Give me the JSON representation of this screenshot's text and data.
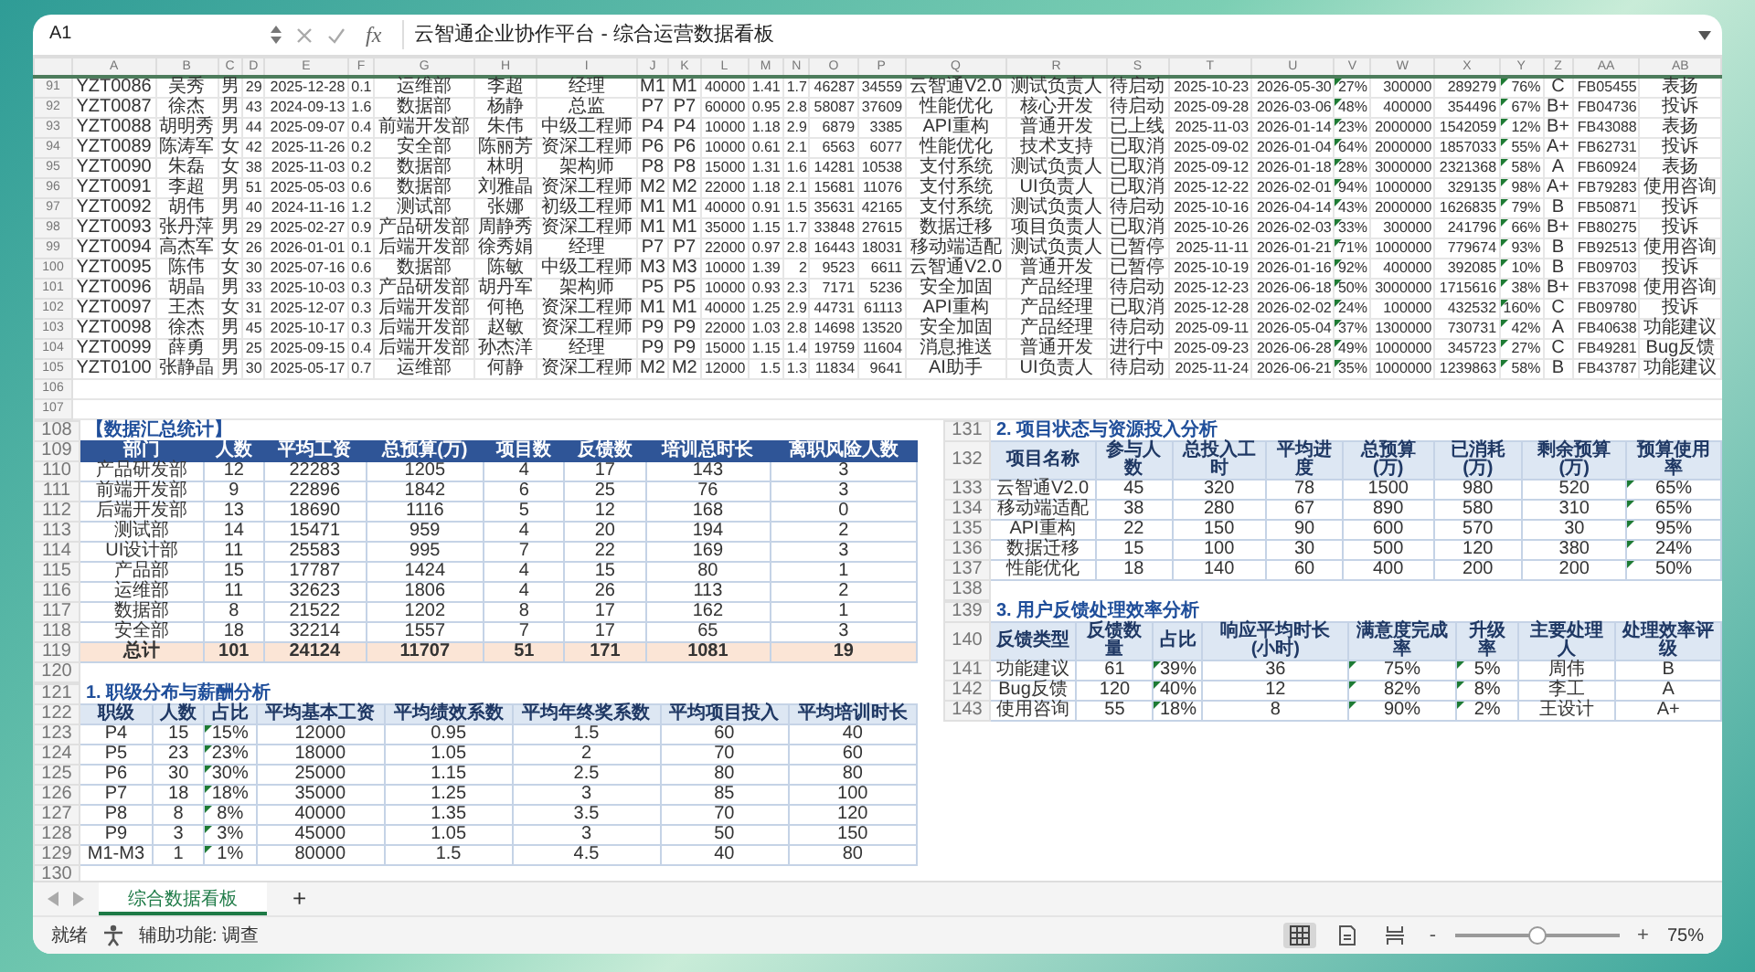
{
  "formula_bar": {
    "cell": "A1",
    "fx": "fx",
    "content": "云智通企业协作平台 - 综合运营数据看板"
  },
  "sheet": {
    "columns": [
      {
        "letter": "A",
        "kind": "text",
        "flag": false
      },
      {
        "letter": "B",
        "kind": "text",
        "flag": false
      },
      {
        "letter": "C",
        "kind": "text",
        "flag": false
      },
      {
        "letter": "D",
        "kind": "number",
        "flag": false
      },
      {
        "letter": "E",
        "kind": "number",
        "flag": false
      },
      {
        "letter": "F",
        "kind": "number",
        "flag": false
      },
      {
        "letter": "G",
        "kind": "text",
        "flag": false
      },
      {
        "letter": "H",
        "kind": "text",
        "flag": false
      },
      {
        "letter": "I",
        "kind": "text",
        "flag": false
      },
      {
        "letter": "J",
        "kind": "text",
        "flag": false
      },
      {
        "letter": "K",
        "kind": "text",
        "flag": false
      },
      {
        "letter": "L",
        "kind": "number",
        "flag": false
      },
      {
        "letter": "M",
        "kind": "number",
        "flag": false
      },
      {
        "letter": "N",
        "kind": "number",
        "flag": false
      },
      {
        "letter": "O",
        "kind": "number",
        "flag": false
      },
      {
        "letter": "P",
        "kind": "number",
        "flag": false
      },
      {
        "letter": "Q",
        "kind": "text",
        "flag": false
      },
      {
        "letter": "R",
        "kind": "text",
        "flag": false
      },
      {
        "letter": "S",
        "kind": "text",
        "flag": false
      },
      {
        "letter": "T",
        "kind": "number",
        "flag": false
      },
      {
        "letter": "U",
        "kind": "number",
        "flag": false
      },
      {
        "letter": "V",
        "kind": "number",
        "flag": true
      },
      {
        "letter": "W",
        "kind": "number",
        "flag": false
      },
      {
        "letter": "X",
        "kind": "number",
        "flag": false
      },
      {
        "letter": "Y",
        "kind": "number",
        "flag": true
      },
      {
        "letter": "Z",
        "kind": "text",
        "flag": false
      },
      {
        "letter": "AA",
        "kind": "number",
        "flag": false
      },
      {
        "letter": "AB",
        "kind": "text",
        "flag": false
      }
    ],
    "rows": [
      {
        "row": "91",
        "cells": [
          "YZT0086",
          "吴秀",
          "男",
          "29",
          "2025-12-28",
          "0.1",
          "运维部",
          "李超",
          "经理",
          "M1",
          "M1",
          "40000",
          "1.41",
          "1.7",
          "46287",
          "34559",
          "云智通V2.0",
          "测试负责人",
          "待启动",
          "2025-10-23",
          "2026-05-30",
          "27%",
          "300000",
          "289279",
          "76%",
          "C",
          "FB05455",
          "表扬"
        ]
      },
      {
        "row": "92",
        "cells": [
          "YZT0087",
          "徐杰",
          "男",
          "43",
          "2024-09-13",
          "1.6",
          "数据部",
          "杨静",
          "总监",
          "P7",
          "P7",
          "60000",
          "0.95",
          "2.8",
          "58087",
          "37609",
          "性能优化",
          "核心开发",
          "待启动",
          "2025-09-28",
          "2026-03-06",
          "48%",
          "400000",
          "354496",
          "67%",
          "B+",
          "FB04736",
          "投诉"
        ]
      },
      {
        "row": "93",
        "cells": [
          "YZT0088",
          "胡明秀",
          "男",
          "44",
          "2025-09-07",
          "0.4",
          "前端开发部",
          "朱伟",
          "中级工程师",
          "P4",
          "P4",
          "10000",
          "1.18",
          "2.9",
          "6879",
          "3385",
          "API重构",
          "普通开发",
          "已上线",
          "2025-11-03",
          "2026-01-14",
          "23%",
          "2000000",
          "1542059",
          "12%",
          "B+",
          "FB43088",
          "表扬"
        ]
      },
      {
        "row": "94",
        "cells": [
          "YZT0089",
          "陈涛军",
          "女",
          "42",
          "2025-11-26",
          "0.2",
          "安全部",
          "陈丽芳",
          "资深工程师",
          "P6",
          "P6",
          "10000",
          "0.61",
          "2.1",
          "6563",
          "6077",
          "性能优化",
          "技术支持",
          "已取消",
          "2025-09-02",
          "2026-01-04",
          "64%",
          "2000000",
          "1857033",
          "55%",
          "A+",
          "FB62731",
          "投诉"
        ]
      },
      {
        "row": "95",
        "cells": [
          "YZT0090",
          "朱磊",
          "女",
          "38",
          "2025-11-03",
          "0.2",
          "数据部",
          "林明",
          "架构师",
          "P8",
          "P8",
          "15000",
          "1.31",
          "1.6",
          "14281",
          "10538",
          "支付系统",
          "测试负责人",
          "已取消",
          "2025-09-12",
          "2026-01-18",
          "28%",
          "3000000",
          "2321368",
          "58%",
          "A",
          "FB60924",
          "表扬"
        ]
      },
      {
        "row": "96",
        "cells": [
          "YZT0091",
          "李超",
          "男",
          "51",
          "2025-05-03",
          "0.6",
          "数据部",
          "刘雅晶",
          "资深工程师",
          "M2",
          "M2",
          "22000",
          "1.18",
          "2.1",
          "15681",
          "11076",
          "支付系统",
          "UI负责人",
          "已取消",
          "2025-12-22",
          "2026-02-01",
          "94%",
          "1000000",
          "329135",
          "98%",
          "A+",
          "FB79283",
          "使用咨询"
        ]
      },
      {
        "row": "97",
        "cells": [
          "YZT0092",
          "胡伟",
          "男",
          "40",
          "2024-11-16",
          "1.2",
          "测试部",
          "张娜",
          "初级工程师",
          "M1",
          "M1",
          "40000",
          "0.91",
          "1.5",
          "35631",
          "42165",
          "支付系统",
          "测试负责人",
          "待启动",
          "2025-10-16",
          "2026-04-14",
          "43%",
          "2000000",
          "1626835",
          "79%",
          "B",
          "FB50871",
          "投诉"
        ]
      },
      {
        "row": "98",
        "cells": [
          "YZT0093",
          "张丹萍",
          "男",
          "29",
          "2025-02-27",
          "0.9",
          "产品研发部",
          "周静秀",
          "资深工程师",
          "M1",
          "M1",
          "35000",
          "1.15",
          "1.7",
          "33848",
          "27615",
          "数据迁移",
          "项目负责人",
          "已取消",
          "2025-10-26",
          "2026-02-03",
          "33%",
          "300000",
          "241796",
          "66%",
          "B+",
          "FB80275",
          "投诉"
        ]
      },
      {
        "row": "99",
        "cells": [
          "YZT0094",
          "高杰军",
          "女",
          "26",
          "2026-01-01",
          "0.1",
          "后端开发部",
          "徐秀娟",
          "经理",
          "P7",
          "P7",
          "22000",
          "0.97",
          "2.8",
          "16443",
          "18031",
          "移动端适配",
          "测试负责人",
          "已暂停",
          "2025-11-11",
          "2026-01-21",
          "71%",
          "1000000",
          "779674",
          "93%",
          "B",
          "FB92513",
          "使用咨询"
        ]
      },
      {
        "row": "100",
        "cells": [
          "YZT0095",
          "陈伟",
          "女",
          "30",
          "2025-07-16",
          "0.6",
          "数据部",
          "陈敏",
          "中级工程师",
          "M3",
          "M3",
          "10000",
          "1.39",
          "2",
          "9523",
          "6611",
          "云智通V2.0",
          "普通开发",
          "已暂停",
          "2025-10-19",
          "2026-01-16",
          "92%",
          "400000",
          "392085",
          "10%",
          "B",
          "FB09703",
          "投诉"
        ]
      },
      {
        "row": "101",
        "cells": [
          "YZT0096",
          "胡晶",
          "男",
          "33",
          "2025-10-03",
          "0.3",
          "产品研发部",
          "胡丹军",
          "架构师",
          "P5",
          "P5",
          "10000",
          "0.93",
          "2.3",
          "7171",
          "5236",
          "安全加固",
          "产品经理",
          "待启动",
          "2025-12-23",
          "2026-06-18",
          "50%",
          "3000000",
          "1715616",
          "38%",
          "B+",
          "FB37098",
          "使用咨询"
        ]
      },
      {
        "row": "102",
        "cells": [
          "YZT0097",
          "王杰",
          "女",
          "31",
          "2025-12-07",
          "0.3",
          "后端开发部",
          "何艳",
          "资深工程师",
          "M1",
          "M1",
          "40000",
          "1.25",
          "2.9",
          "44731",
          "61113",
          "API重构",
          "产品经理",
          "已取消",
          "2025-12-28",
          "2026-02-02",
          "24%",
          "100000",
          "432532",
          "160%",
          "C",
          "FB09780",
          "投诉"
        ]
      },
      {
        "row": "103",
        "cells": [
          "YZT0098",
          "徐杰",
          "男",
          "45",
          "2025-10-17",
          "0.3",
          "后端开发部",
          "赵敏",
          "资深工程师",
          "P9",
          "P9",
          "22000",
          "1.03",
          "2.8",
          "14698",
          "13520",
          "安全加固",
          "产品经理",
          "待启动",
          "2025-09-11",
          "2026-05-04",
          "37%",
          "1300000",
          "730731",
          "42%",
          "A",
          "FB40638",
          "功能建议"
        ]
      },
      {
        "row": "104",
        "cells": [
          "YZT0099",
          "薛勇",
          "男",
          "25",
          "2025-09-15",
          "0.4",
          "后端开发部",
          "孙杰洋",
          "经理",
          "P9",
          "P9",
          "15000",
          "1.15",
          "1.4",
          "19759",
          "11604",
          "消息推送",
          "普通开发",
          "进行中",
          "2025-09-23",
          "2026-06-28",
          "49%",
          "1000000",
          "345723",
          "27%",
          "C",
          "FB49281",
          "Bug反馈"
        ]
      },
      {
        "row": "105",
        "cells": [
          "YZT0100",
          "张静晶",
          "男",
          "30",
          "2025-05-17",
          "0.7",
          "运维部",
          "何静",
          "资深工程师",
          "M2",
          "M2",
          "12000",
          "1.5",
          "1.3",
          "11834",
          "9641",
          "AI助手",
          "UI负责人",
          "待启动",
          "2025-11-24",
          "2026-06-21",
          "35%",
          "1000000",
          "1239863",
          "58%",
          "B",
          "FB43787",
          "功能建议"
        ]
      }
    ],
    "blank_rows": [
      "106",
      "107"
    ]
  },
  "summary": {
    "title_row": "108",
    "title": "【数据汇总统计】",
    "header_row": "109",
    "columns": [
      "部门",
      "人数",
      "平均工资",
      "总预算(万)",
      "项目数",
      "反馈数",
      "培训总时长",
      "离职风险人数"
    ],
    "rows": [
      {
        "row": "110",
        "kind": "data",
        "cells": [
          "产品研发部",
          "12",
          "22283",
          "1205",
          "4",
          "17",
          "143",
          "3"
        ]
      },
      {
        "row": "111",
        "kind": "data",
        "cells": [
          "前端开发部",
          "9",
          "22896",
          "1842",
          "6",
          "25",
          "76",
          "3"
        ]
      },
      {
        "row": "112",
        "kind": "data",
        "cells": [
          "后端开发部",
          "13",
          "18690",
          "1116",
          "5",
          "12",
          "168",
          "0"
        ]
      },
      {
        "row": "113",
        "kind": "data",
        "cells": [
          "测试部",
          "14",
          "15471",
          "959",
          "4",
          "20",
          "194",
          "2"
        ]
      },
      {
        "row": "114",
        "kind": "data",
        "cells": [
          "UI设计部",
          "11",
          "25583",
          "995",
          "7",
          "22",
          "169",
          "3"
        ]
      },
      {
        "row": "115",
        "kind": "data",
        "cells": [
          "产品部",
          "15",
          "17787",
          "1424",
          "4",
          "15",
          "80",
          "1"
        ]
      },
      {
        "row": "116",
        "kind": "data",
        "cells": [
          "运维部",
          "11",
          "32623",
          "1806",
          "4",
          "26",
          "113",
          "2"
        ]
      },
      {
        "row": "117",
        "kind": "data",
        "cells": [
          "数据部",
          "8",
          "21522",
          "1202",
          "8",
          "17",
          "162",
          "1"
        ]
      },
      {
        "row": "118",
        "kind": "data",
        "cells": [
          "安全部",
          "18",
          "32214",
          "1557",
          "7",
          "17",
          "65",
          "3"
        ]
      },
      {
        "row": "119",
        "kind": "total",
        "cells": [
          "总计",
          "101",
          "24124",
          "11707",
          "51",
          "171",
          "1081",
          "19"
        ]
      }
    ],
    "blank_row": "120"
  },
  "sections": [
    {
      "title_row": "121",
      "title": "1. 职级分布与薪酬分析",
      "header_row": "122",
      "columns": [
        {
          "name": "职级",
          "flag": false
        },
        {
          "name": "人数",
          "flag": false
        },
        {
          "name": "占比",
          "flag": true
        },
        {
          "name": "平均基本工资",
          "flag": false
        },
        {
          "name": "平均绩效系数",
          "flag": false
        },
        {
          "name": "平均年终奖系数",
          "flag": false
        },
        {
          "name": "平均项目投入",
          "flag": false
        },
        {
          "name": "平均培训时长",
          "flag": false
        }
      ],
      "rows": [
        {
          "row": "123",
          "cells": [
            "P4",
            "15",
            "15%",
            "12000",
            "0.95",
            "1.5",
            "60",
            "40"
          ]
        },
        {
          "row": "124",
          "cells": [
            "P5",
            "23",
            "23%",
            "18000",
            "1.05",
            "2",
            "70",
            "60"
          ]
        },
        {
          "row": "125",
          "cells": [
            "P6",
            "30",
            "30%",
            "25000",
            "1.15",
            "2.5",
            "80",
            "80"
          ]
        },
        {
          "row": "126",
          "cells": [
            "P7",
            "18",
            "18%",
            "35000",
            "1.25",
            "3",
            "85",
            "100"
          ]
        },
        {
          "row": "127",
          "cells": [
            "P8",
            "8",
            "8%",
            "40000",
            "1.35",
            "3.5",
            "70",
            "120"
          ]
        },
        {
          "row": "128",
          "cells": [
            "P9",
            "3",
            "3%",
            "45000",
            "1.05",
            "3",
            "50",
            "150"
          ]
        },
        {
          "row": "129",
          "cells": [
            "M1-M3",
            "1",
            "1%",
            "80000",
            "1.5",
            "4.5",
            "40",
            "80"
          ]
        }
      ],
      "blank_row": "130"
    },
    {
      "title_row": "131",
      "title": "2. 项目状态与资源投入分析",
      "header_row": "132",
      "columns": [
        {
          "name": "项目名称",
          "flag": false
        },
        {
          "name": "参与人数",
          "flag": false
        },
        {
          "name": "总投入工时",
          "flag": false
        },
        {
          "name": "平均进度",
          "flag": false
        },
        {
          "name": "总预算(万)",
          "flag": false
        },
        {
          "name": "已消耗(万)",
          "flag": false
        },
        {
          "name": "剩余预算(万)",
          "flag": false
        },
        {
          "name": "预算使用率",
          "flag": true
        }
      ],
      "rows": [
        {
          "row": "133",
          "cells": [
            "云智通V2.0",
            "45",
            "320",
            "78",
            "1500",
            "980",
            "520",
            "65%"
          ]
        },
        {
          "row": "134",
          "cells": [
            "移动端适配",
            "38",
            "280",
            "67",
            "890",
            "580",
            "310",
            "65%"
          ]
        },
        {
          "row": "135",
          "cells": [
            "API重构",
            "22",
            "150",
            "90",
            "600",
            "570",
            "30",
            "95%"
          ]
        },
        {
          "row": "136",
          "cells": [
            "数据迁移",
            "15",
            "100",
            "30",
            "500",
            "120",
            "380",
            "24%"
          ]
        },
        {
          "row": "137",
          "cells": [
            "性能优化",
            "18",
            "140",
            "60",
            "400",
            "200",
            "200",
            "50%"
          ]
        }
      ],
      "blank_row": "138"
    },
    {
      "title_row": "139",
      "title": "3. 用户反馈处理效率分析",
      "header_row": "140",
      "columns": [
        {
          "name": "反馈类型",
          "flag": false
        },
        {
          "name": "反馈数量",
          "flag": false
        },
        {
          "name": "占比",
          "flag": true
        },
        {
          "name": "响应平均时长(小时)",
          "flag": false
        },
        {
          "name": "满意度完成率",
          "flag": true
        },
        {
          "name": "升级率",
          "flag": true
        },
        {
          "name": "主要处理人",
          "flag": false
        },
        {
          "name": "处理效率评级",
          "flag": false
        }
      ],
      "rows": [
        {
          "row": "141",
          "cells": [
            "功能建议",
            "61",
            "39%",
            "36",
            "75%",
            "5%",
            "周伟",
            "B"
          ]
        },
        {
          "row": "142",
          "cells": [
            "Bug反馈",
            "120",
            "40%",
            "12",
            "82%",
            "8%",
            "李工",
            "A"
          ]
        },
        {
          "row": "143",
          "cells": [
            "使用咨询",
            "55",
            "18%",
            "8",
            "90%",
            "2%",
            "王设计",
            "A+"
          ]
        }
      ]
    }
  ],
  "sheet_tabs": [
    {
      "label": "综合数据看板",
      "selected": true
    }
  ],
  "add_sheet": "+",
  "status_bar": {
    "ready": "就绪",
    "accessibility": "辅助功能: 调查",
    "views": [
      {
        "selected": true
      },
      {
        "selected": false
      },
      {
        "selected": false
      }
    ],
    "zoom_out": "-",
    "zoom_in": "+",
    "zoom": {
      "level": 0.5
    },
    "zoom_label": "75%"
  }
}
